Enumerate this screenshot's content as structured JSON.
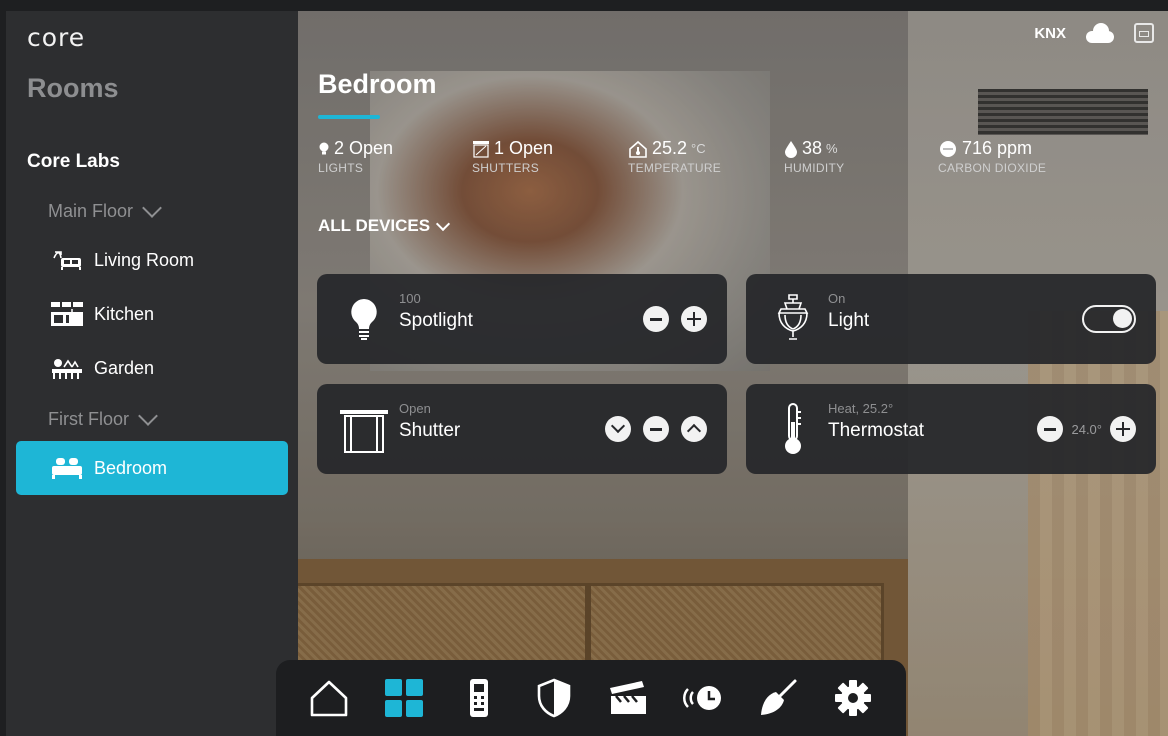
{
  "header": {
    "logo": "core",
    "protocol_label": "KNX",
    "cloud_icon": "cloud-icon",
    "gateway_icon": "gateway-icon"
  },
  "sidebar": {
    "title": "Rooms",
    "site": "Core Labs",
    "floors": [
      {
        "label": "Main Floor",
        "rooms": [
          {
            "label": "Living Room",
            "icon": "sofa-icon"
          },
          {
            "label": "Kitchen",
            "icon": "kitchen-icon"
          },
          {
            "label": "Garden",
            "icon": "garden-icon"
          }
        ]
      },
      {
        "label": "First Floor",
        "rooms": [
          {
            "label": "Bedroom",
            "icon": "bed-icon",
            "selected": true
          }
        ]
      }
    ]
  },
  "room": {
    "title": "Bedroom",
    "stats": [
      {
        "value": "2 Open",
        "unit": "",
        "label": "LIGHTS",
        "icon": "bulb-icon"
      },
      {
        "value": "1 Open",
        "unit": "",
        "label": "SHUTTERS",
        "icon": "shutter-icon"
      },
      {
        "value": "25.2",
        "unit": "°C",
        "label": "TEMPERATURE",
        "icon": "house-temperature-icon"
      },
      {
        "value": "38",
        "unit": "%",
        "label": "HUMIDITY",
        "icon": "droplet-icon"
      },
      {
        "value": "716 ppm",
        "unit": "",
        "label": "CARBON DIOXIDE",
        "icon": "co2-icon"
      }
    ],
    "filter_label": "ALL DEVICES"
  },
  "devices": [
    {
      "name": "Spotlight",
      "status": "100",
      "icon": "bulb-icon",
      "type": "dimmer"
    },
    {
      "name": "Light",
      "status": "On",
      "icon": "chandelier-icon",
      "type": "switch",
      "on": true
    },
    {
      "name": "Shutter",
      "status": "Open",
      "icon": "shutter-icon",
      "type": "shutter"
    },
    {
      "name": "Thermostat",
      "status": "Heat, 25.2°",
      "icon": "thermometer-icon",
      "type": "thermostat",
      "setpoint": "24.0°"
    }
  ],
  "bottom_nav": [
    {
      "icon": "home-icon"
    },
    {
      "icon": "grid-icon",
      "active": true
    },
    {
      "icon": "remote-icon"
    },
    {
      "icon": "shield-icon"
    },
    {
      "icon": "clapperboard-icon"
    },
    {
      "icon": "schedule-icon"
    },
    {
      "icon": "broom-icon"
    },
    {
      "icon": "gear-icon"
    }
  ],
  "colors": {
    "accent": "#1eb6d6",
    "sidebar_bg": "#2d2e30",
    "card_bg": "#26272a",
    "nav_bg": "#1d1e20"
  }
}
